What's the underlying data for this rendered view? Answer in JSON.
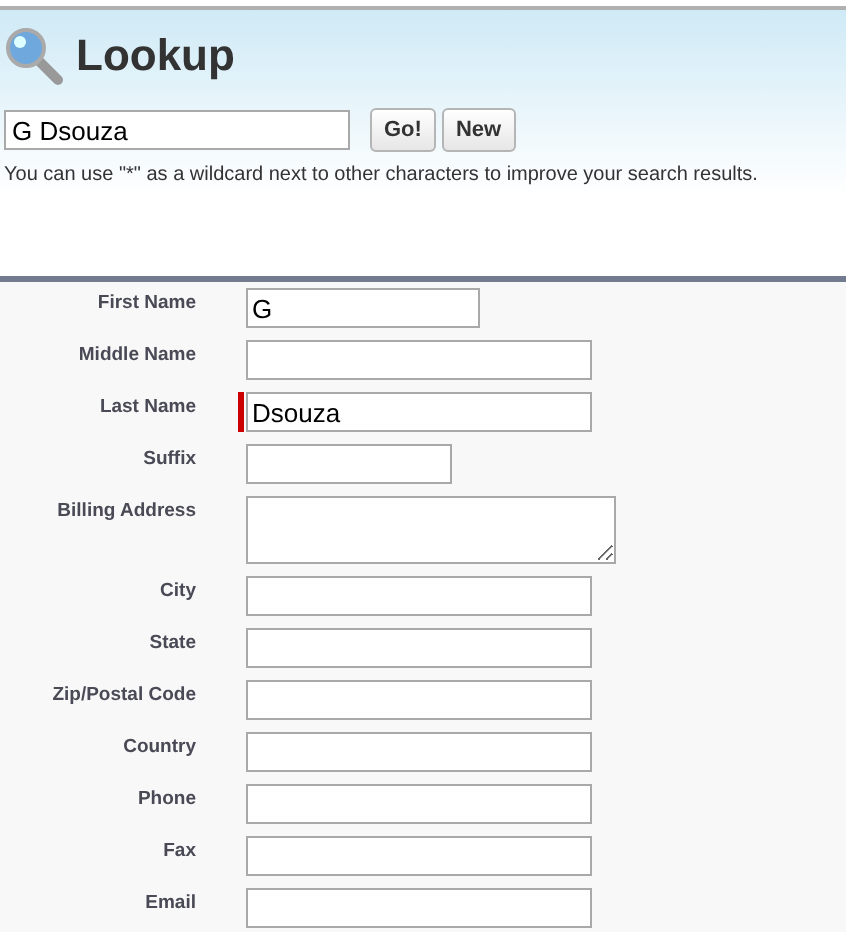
{
  "header": {
    "title": "Lookup",
    "search": {
      "value": "G Dsouza"
    },
    "buttons": [
      "Go!",
      "New"
    ],
    "hint": "You can use \"*\" as a wildcard next to other characters to improve your search results."
  },
  "form": {
    "fields": [
      {
        "label": "First Name",
        "kind": "short",
        "value": "G",
        "required": false
      },
      {
        "label": "Middle Name",
        "kind": "long",
        "required": false
      },
      {
        "label": "Last Name",
        "kind": "long",
        "value": "Dsouza",
        "required": true
      },
      {
        "label": "Suffix",
        "kind": "tiny",
        "required": false
      },
      {
        "label": "Billing Address",
        "kind": "textarea",
        "required": false
      },
      {
        "label": "City",
        "kind": "long",
        "required": false
      },
      {
        "label": "State",
        "kind": "long",
        "required": false
      },
      {
        "label": "Zip/Postal Code",
        "kind": "long",
        "required": false
      },
      {
        "label": "Country",
        "kind": "long",
        "required": false
      },
      {
        "label": "Phone",
        "kind": "long",
        "required": false
      },
      {
        "label": "Fax",
        "kind": "long",
        "required": false
      },
      {
        "label": "Email",
        "kind": "long",
        "required": false
      }
    ]
  }
}
